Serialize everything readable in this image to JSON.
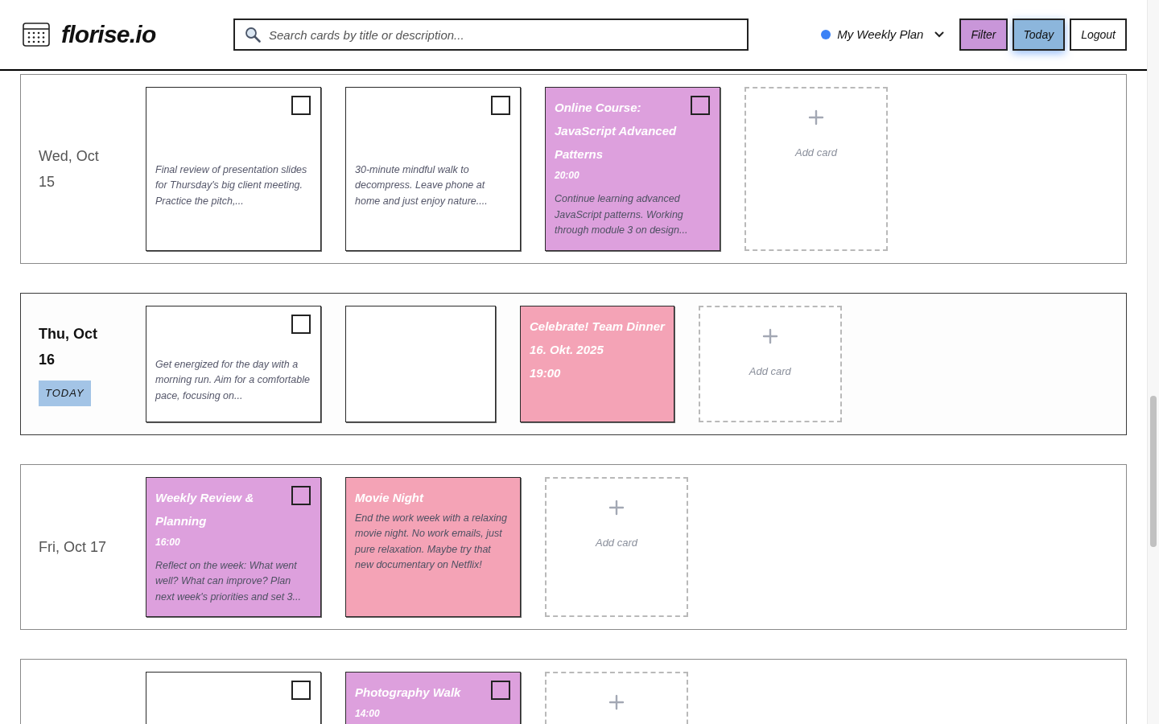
{
  "header": {
    "logo": "florise.io",
    "search": {
      "placeholder": "Search cards by title or description..."
    },
    "plan": {
      "label": "My Weekly Plan",
      "color": "#3b82f6"
    },
    "buttons": [
      {
        "label": "Filter",
        "color": "#c996d9",
        "focused": false
      },
      {
        "label": "Today",
        "color": "#8cb6dc",
        "focused": true
      },
      {
        "label": "Logout",
        "color": "#ffffff",
        "focused": false
      }
    ]
  },
  "days": [
    {
      "label": "Wed, Oct 15",
      "today": false,
      "cards": [
        {
          "kind": "task",
          "color": "#ffffff",
          "checked": false,
          "description": "Final review of presentation slides for Thursday's big client meeting. Practice the pitch,..."
        },
        {
          "kind": "task",
          "color": "#ffffff",
          "checked": false,
          "description": "30-minute mindful walk to decompress. Leave phone at home and just enjoy nature...."
        },
        {
          "kind": "task",
          "color": "#dda0dd",
          "checked": false,
          "title": "Online Course: JavaScript Advanced Patterns",
          "time": "20:00",
          "description": "Continue learning advanced JavaScript patterns. Working through module 3 on design..."
        },
        {
          "kind": "add",
          "label": "Add card"
        }
      ]
    },
    {
      "label": "Thu, Oct 16",
      "today": true,
      "badge": "TODAY",
      "cards": [
        {
          "kind": "task",
          "color": "#ffffff",
          "checked": false,
          "description": "Get energized for the day with a morning run. Aim for a comfortable pace, focusing on..."
        },
        {
          "kind": "event",
          "color": "#ffffff"
        },
        {
          "kind": "event",
          "color": "#f4a3b6",
          "title": "Celebrate! Team Dinner",
          "title_lines": [
            "16. Okt. 2025",
            "19:00"
          ]
        },
        {
          "kind": "add",
          "label": "Add card"
        }
      ]
    },
    {
      "label": "Fri, Oct 17",
      "today": false,
      "cards": [
        {
          "kind": "task",
          "color": "#dda0dd",
          "checked": false,
          "title": "Weekly Review & Planning",
          "time": "16:00",
          "description": "Reflect on the week: What went well? What can improve? Plan next week's priorities and set 3..."
        },
        {
          "kind": "event",
          "color": "#f4a3b6",
          "title": "Movie Night",
          "description": "End the work week with a relaxing movie night. No work emails, just pure relaxation. Maybe try that new documentary on Netflix!"
        },
        {
          "kind": "add",
          "label": "Add card"
        }
      ]
    },
    {
      "today": false,
      "cards": [
        {
          "kind": "task",
          "color": "#ffffff",
          "checked": false
        },
        {
          "kind": "task",
          "color": "#dda0dd",
          "checked": false,
          "title": "Photography Walk",
          "time": "14:00"
        },
        {
          "kind": "add"
        }
      ]
    }
  ]
}
